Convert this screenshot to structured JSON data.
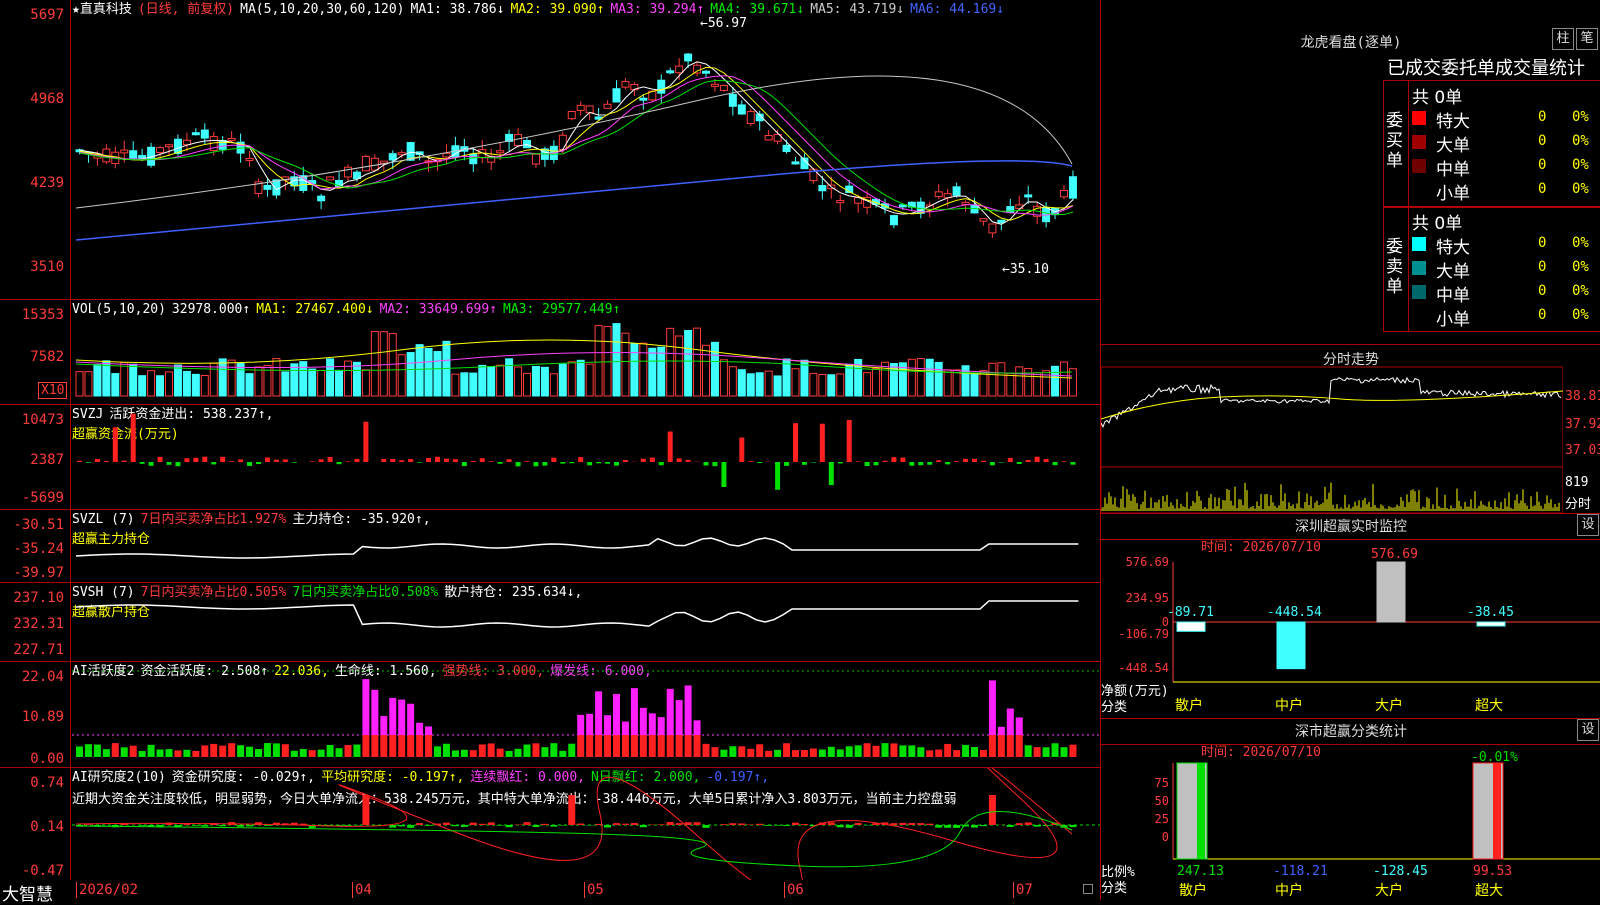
{
  "app": {
    "name": "大智慧"
  },
  "kline": {
    "title_name": "★直真科技",
    "title_mode": "(日线, 前复权)",
    "ma_label": "MA(5,10,20,30,60,120)",
    "ma": [
      {
        "label": "MA1: 38.786↓",
        "color": "#ffffff"
      },
      {
        "label": "MA2: 39.090↑",
        "color": "#ffff00"
      },
      {
        "label": "MA3: 39.294↑",
        "color": "#ff40ff"
      },
      {
        "label": "MA4: 39.671↓",
        "color": "#00e000"
      },
      {
        "label": "MA5: 43.719↓",
        "color": "#c8c8c8"
      },
      {
        "label": "MA6: 44.169↓",
        "color": "#4060ff"
      }
    ],
    "yticks": [
      "5697",
      "4968",
      "4239",
      "3510"
    ],
    "high_label": "←56.97",
    "low_label": "←35.10"
  },
  "vol": {
    "title": "VOL(5,10,20)",
    "value": "32978.000↑",
    "ma": [
      {
        "label": "MA1: 27467.400↓",
        "color": "#ffff00"
      },
      {
        "label": "MA2: 33649.699↑",
        "color": "#ff40ff"
      },
      {
        "label": "MA3: 29577.449↑",
        "color": "#00e000"
      }
    ],
    "yticks": [
      "15353",
      "7582"
    ],
    "unit": "X10"
  },
  "svzj": {
    "title": "SVZJ",
    "item": "活跃资金进出: 538.237↑,",
    "sub": "超赢资金流(万元)",
    "yticks": [
      "10473",
      "2387",
      "-5699"
    ]
  },
  "svzl": {
    "title": "SVZL (7)",
    "item1": "7日内买卖净占比1.927%",
    "item2": "主力持仓: -35.920↑,",
    "sub": "超赢主力持仓",
    "yticks": [
      "-30.51",
      "-35.24",
      "-39.97"
    ]
  },
  "svsh": {
    "title": "SVSH (7)",
    "item1": "7日内买卖净占比0.505%",
    "item2": "7日内买卖净占比0.508%",
    "item3": "散户持仓: 235.634↓,",
    "sub": "超赢散户持仓",
    "yticks": [
      "237.10",
      "232.31",
      "227.71"
    ]
  },
  "ai1": {
    "title": "AI活跃度2",
    "item1": "资金活跃度: 2.508↑",
    "item2": "22.036,",
    "item3": "生命线: 1.560,",
    "item4": "强势线: 3.000,",
    "item5": "爆发线: 6.000,",
    "yticks": [
      "22.04",
      "10.89",
      "0.00"
    ]
  },
  "ai2": {
    "title": "AI研究度2(10)",
    "item1": "资金研究度: -0.029↑,",
    "item2": "平均研究度: -0.197↑,",
    "item3": "连续飘红: 0.000,",
    "item4": "N日飘红: 2.000,",
    "item5": "-0.197↑,",
    "comment": "近期大资金关注度较低，明显弱势，今日大单净流入：538.245万元，其中特大单净流出：-38.446万元，大单5日累计净入3.803万元，当前主力控盘弱",
    "yticks": [
      "0.74",
      "0.14",
      "-0.47"
    ]
  },
  "xaxis": [
    "2026/02",
    "04",
    "05",
    "06",
    "07"
  ],
  "lhb": {
    "title": "龙虎看盘(逐单)",
    "btn1": "柱",
    "btn2": "笔",
    "subtitle": "已成交委托单成交量统计",
    "buy_label": "委买单",
    "sell_label": "委卖单",
    "buy_total": "共 0单",
    "sell_total": "共 0单",
    "buy": [
      {
        "name": "特大",
        "count": "0",
        "pct": "0%",
        "color": "#ff0000"
      },
      {
        "name": "大单",
        "count": "0",
        "pct": "0%",
        "color": "#a00000"
      },
      {
        "name": "中单",
        "count": "0",
        "pct": "0%",
        "color": "#700000"
      },
      {
        "name": "小单",
        "count": "0",
        "pct": "0%",
        "color": "#000000"
      }
    ],
    "sell": [
      {
        "name": "特大",
        "count": "0",
        "pct": "0%",
        "color": "#00ffff"
      },
      {
        "name": "大单",
        "count": "0",
        "pct": "0%",
        "color": "#009090"
      },
      {
        "name": "中单",
        "count": "0",
        "pct": "0%",
        "color": "#006868"
      },
      {
        "name": "小单",
        "count": "0",
        "pct": "0%",
        "color": "#000000"
      }
    ]
  },
  "intraday": {
    "title": "分时走势",
    "yticks": [
      "38.81",
      "37.92",
      "37.03"
    ],
    "vol_label": "819",
    "vol_unit": "分时"
  },
  "sz_monitor": {
    "title": "深圳超赢实时监控",
    "btn": "设",
    "time": "时间: 2026/07/10",
    "unit": "净额(万元)",
    "cat_label": "分类",
    "yticks": [
      "576.69",
      "234.95",
      "0",
      "-106.79",
      "-448.54"
    ],
    "categories": [
      "散户",
      "中户",
      "大户",
      "超大"
    ],
    "values": [
      "-89.71",
      "-448.54",
      "576.69",
      "-38.45"
    ]
  },
  "sz_stats": {
    "title": "深市超赢分类统计",
    "btn": "设",
    "time": "时间: 2026/07/10",
    "unit": "比例%",
    "cat_label": "分类",
    "yticks": [
      "75",
      "50",
      "25",
      "0"
    ],
    "categories": [
      "散户",
      "中户",
      "大户",
      "超大"
    ],
    "values": [
      "247.13",
      "-118.21",
      "-128.45",
      "99.53"
    ],
    "top_label": "-0.01%"
  }
}
